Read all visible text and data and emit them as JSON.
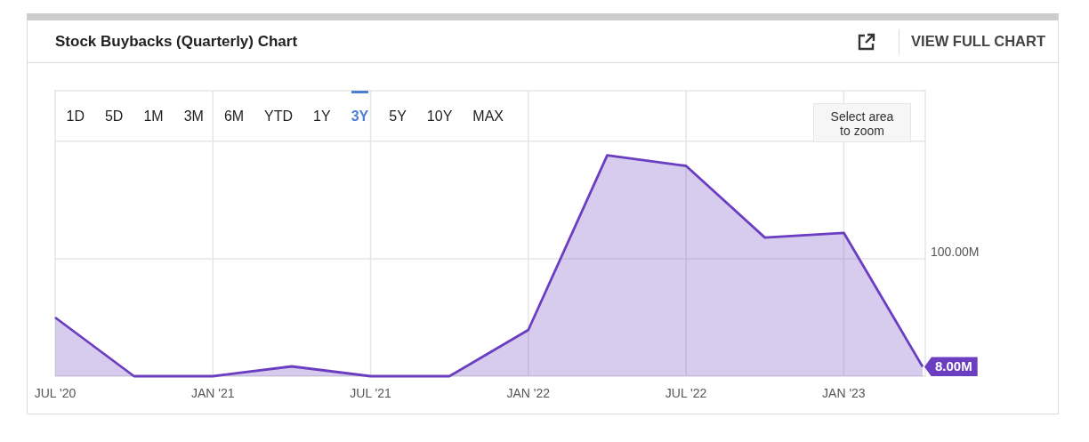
{
  "card": {
    "title": "Stock Buybacks (Quarterly) Chart",
    "full_chart_link": "VIEW FULL CHART"
  },
  "range_buttons": [
    {
      "label": "1D",
      "selected": false
    },
    {
      "label": "5D",
      "selected": false
    },
    {
      "label": "1M",
      "selected": false
    },
    {
      "label": "3M",
      "selected": false
    },
    {
      "label": "6M",
      "selected": false
    },
    {
      "label": "YTD",
      "selected": false
    },
    {
      "label": "1Y",
      "selected": false
    },
    {
      "label": "3Y",
      "selected": true
    },
    {
      "label": "5Y",
      "selected": false
    },
    {
      "label": "10Y",
      "selected": false
    },
    {
      "label": "MAX",
      "selected": false
    }
  ],
  "zoom_hint": "Select area to zoom",
  "chart_data": {
    "type": "area",
    "categories": [
      "JUL '20",
      null,
      "JAN '21",
      null,
      "JUL '21",
      null,
      "JAN '22",
      null,
      "JUL '22",
      null,
      "JAN '23",
      null
    ],
    "series": [
      {
        "color": "#6a3dc1",
        "values": [
          50000000,
          0,
          0,
          8300000,
          0,
          0,
          39400000,
          188000000,
          179000000,
          118000000,
          122000000,
          8000000
        ]
      }
    ],
    "ylim": [
      0,
      243000000
    ],
    "grid": true,
    "yticks": [
      {
        "value": 100000000,
        "label": "100.00M"
      }
    ]
  },
  "last_value_badge": "8.00M"
}
